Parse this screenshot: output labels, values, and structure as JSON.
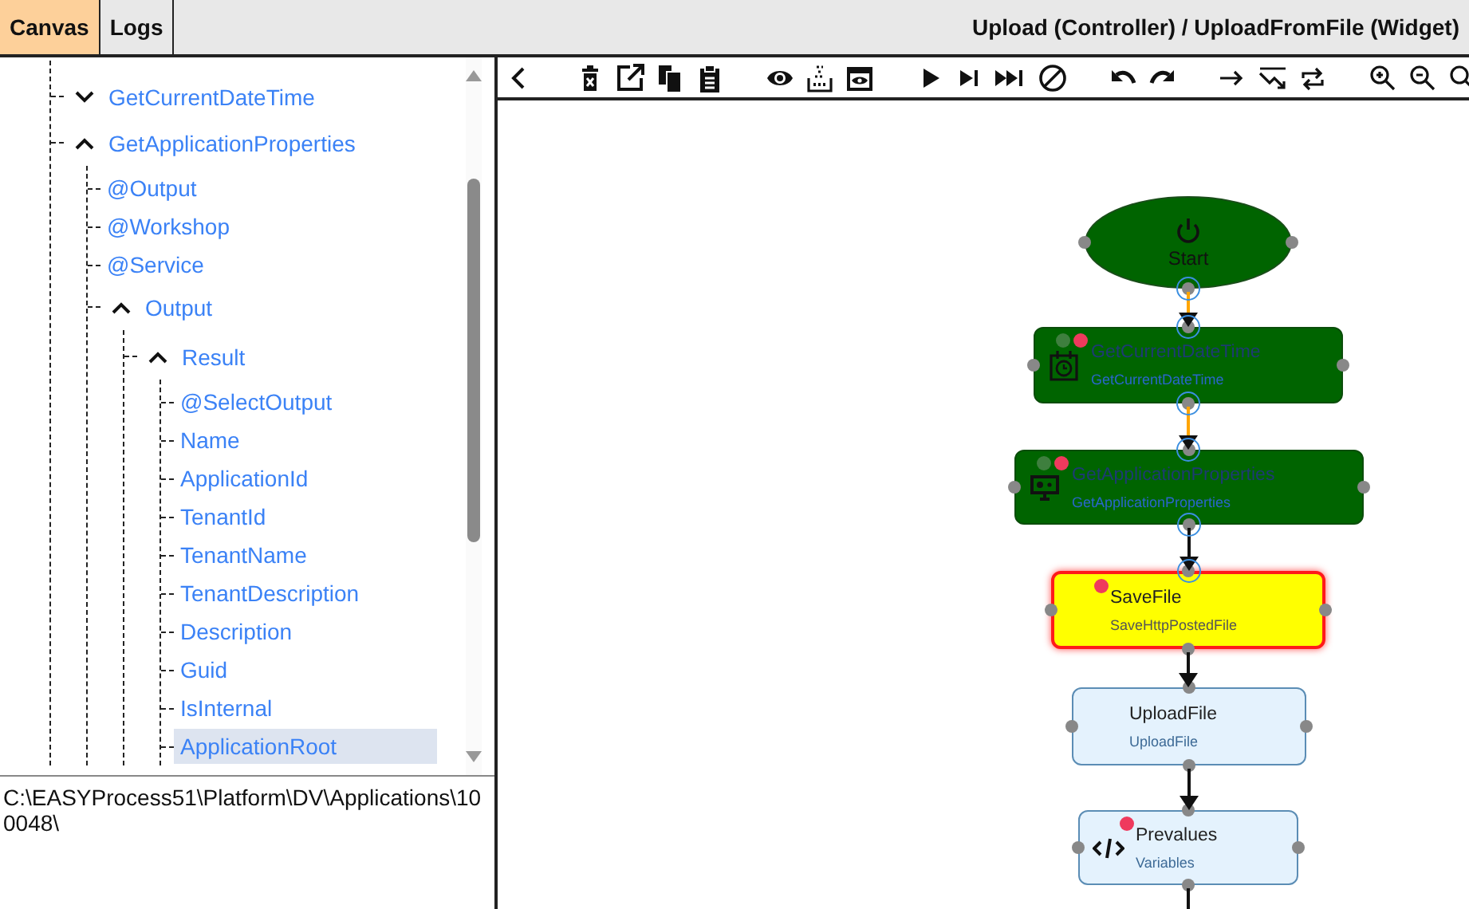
{
  "tabs": [
    {
      "label": "Canvas",
      "selected": true
    },
    {
      "label": "Logs",
      "selected": false
    }
  ],
  "title": "Upload (Controller) / UploadFromFile (Widget)",
  "tree": [
    {
      "label": "GetCurrentDateTime",
      "expanded": false,
      "selected": false
    },
    {
      "label": "GetApplicationProperties",
      "expanded": true,
      "selected": false,
      "children": [
        {
          "label": "@Output",
          "selected": false
        },
        {
          "label": "@Workshop",
          "selected": false
        },
        {
          "label": "@Service",
          "selected": false
        },
        {
          "label": "Output",
          "expanded": true,
          "selected": false,
          "children": [
            {
              "label": "Result",
              "expanded": true,
              "selected": false,
              "children": [
                {
                  "label": "@SelectOutput",
                  "selected": false
                },
                {
                  "label": "Name",
                  "selected": false
                },
                {
                  "label": "ApplicationId",
                  "selected": false
                },
                {
                  "label": "TenantId",
                  "selected": false
                },
                {
                  "label": "TenantName",
                  "selected": false
                },
                {
                  "label": "TenantDescription",
                  "selected": false
                },
                {
                  "label": "Description",
                  "selected": false
                },
                {
                  "label": "Guid",
                  "selected": false
                },
                {
                  "label": "IsInternal",
                  "selected": false
                },
                {
                  "label": "ApplicationRoot",
                  "selected": true
                }
              ]
            }
          ]
        }
      ]
    }
  ],
  "value_box": "C:\\EASYProcess51\\Platform\\DV\\Applications\\100048\\",
  "flow": {
    "nodes": [
      {
        "kind": "start",
        "title": "Start",
        "executed": true,
        "current": false
      },
      {
        "kind": "datetime",
        "title": "GetCurrentDateTime",
        "subtitle": "GetCurrentDateTime",
        "executed": true,
        "current": false,
        "visited": true,
        "breakpoint": true
      },
      {
        "kind": "properties",
        "title": "GetApplicationProperties",
        "subtitle": "GetApplicationProperties",
        "executed": true,
        "current": false,
        "visited": true,
        "breakpoint": true
      },
      {
        "kind": "file",
        "title": "SaveFile",
        "subtitle": "SaveHttpPostedFile",
        "executed": false,
        "current": true,
        "visited": false,
        "breakpoint": true
      },
      {
        "kind": "upload",
        "title": "UploadFile",
        "subtitle": "UploadFile",
        "executed": false,
        "current": false,
        "visited": false,
        "breakpoint": false
      },
      {
        "kind": "script",
        "title": "Prevalues",
        "subtitle": "Variables",
        "executed": false,
        "current": false,
        "visited": false,
        "breakpoint": true
      }
    ],
    "connectors": [
      {
        "executed": true
      },
      {
        "executed": true
      },
      {
        "executed": false
      },
      {
        "executed": false
      },
      {
        "executed": false
      }
    ]
  }
}
